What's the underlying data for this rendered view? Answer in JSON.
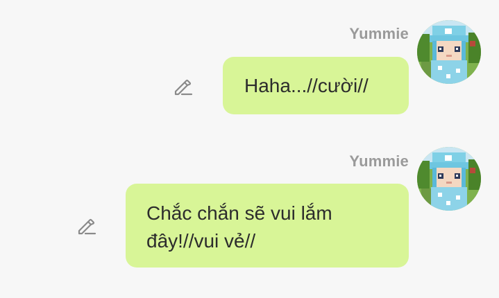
{
  "messages": [
    {
      "sender": "Yummie",
      "text": "Haha...//cười//",
      "avatar_icon": "minecraft-character-avatar",
      "edit_icon": "pencil-icon"
    },
    {
      "sender": "Yummie",
      "text": "Chắc chắn sẽ vui lắm đây!//vui vẻ//",
      "avatar_icon": "minecraft-character-avatar",
      "edit_icon": "pencil-icon"
    }
  ],
  "colors": {
    "background": "#f7f7f7",
    "bubble": "#d8f597",
    "sender_name": "#9a9a9a",
    "message_text": "#2c2c2c",
    "icon": "#8a8a8a"
  }
}
